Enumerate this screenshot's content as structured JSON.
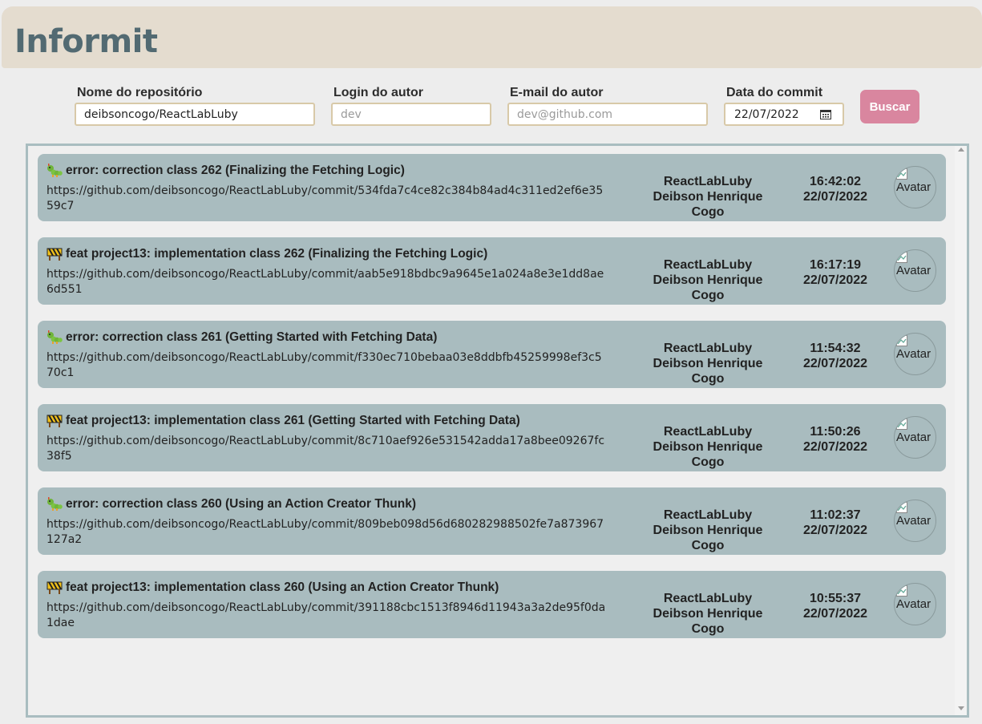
{
  "app": {
    "title": "Informit"
  },
  "filters": {
    "repo": {
      "label": "Nome do repositório",
      "value": "deibsoncogo/ReactLabLuby",
      "placeholder": ""
    },
    "login": {
      "label": "Login do autor",
      "value": "",
      "placeholder": "dev"
    },
    "email": {
      "label": "E-mail do autor",
      "value": "",
      "placeholder": "dev@github.com"
    },
    "date": {
      "label": "Data do commit",
      "value": "22/07/2022",
      "icon": "calendar-icon"
    },
    "search_label": "Buscar"
  },
  "colors": {
    "header_bg": "#e4dccf",
    "brand": "#526a72",
    "accent_button": "#d9869f",
    "card_bg": "#a9bcbf",
    "input_border": "#d8c9a8"
  },
  "commits": [
    {
      "icon": "caterpillar-icon",
      "message": "error: correction class 262 (Finalizing the Fetching Logic)",
      "url": "https://github.com/deibsoncogo/ReactLabLuby/commit/534fda7c4ce82c384b84ad4c311ed2ef6e3559c7",
      "repo": "ReactLabLuby",
      "author": "Deibson Henrique Cogo",
      "time": "16:42:02",
      "date": "22/07/2022",
      "avatar_alt": "Avatar"
    },
    {
      "icon": "construction-icon",
      "message": "feat project13: implementation class 262 (Finalizing the Fetching Logic)",
      "url": "https://github.com/deibsoncogo/ReactLabLuby/commit/aab5e918bdbc9a9645e1a024a8e3e1dd8ae6d551",
      "repo": "ReactLabLuby",
      "author": "Deibson Henrique Cogo",
      "time": "16:17:19",
      "date": "22/07/2022",
      "avatar_alt": "Avatar"
    },
    {
      "icon": "caterpillar-icon",
      "message": "error: correction class 261 (Getting Started with Fetching Data)",
      "url": "https://github.com/deibsoncogo/ReactLabLuby/commit/f330ec710bebaa03e8ddbfb45259998ef3c570c1",
      "repo": "ReactLabLuby",
      "author": "Deibson Henrique Cogo",
      "time": "11:54:32",
      "date": "22/07/2022",
      "avatar_alt": "Avatar"
    },
    {
      "icon": "construction-icon",
      "message": "feat project13: implementation class 261 (Getting Started with Fetching Data)",
      "url": "https://github.com/deibsoncogo/ReactLabLuby/commit/8c710aef926e531542adda17a8bee09267fc38f5",
      "repo": "ReactLabLuby",
      "author": "Deibson Henrique Cogo",
      "time": "11:50:26",
      "date": "22/07/2022",
      "avatar_alt": "Avatar"
    },
    {
      "icon": "caterpillar-icon",
      "message": "error: correction class 260 (Using an Action Creator Thunk)",
      "url": "https://github.com/deibsoncogo/ReactLabLuby/commit/809beb098d56d680282988502fe7a873967127a2",
      "repo": "ReactLabLuby",
      "author": "Deibson Henrique Cogo",
      "time": "11:02:37",
      "date": "22/07/2022",
      "avatar_alt": "Avatar"
    },
    {
      "icon": "construction-icon",
      "message": "feat project13: implementation class 260 (Using an Action Creator Thunk)",
      "url": "https://github.com/deibsoncogo/ReactLabLuby/commit/391188cbc1513f8946d11943a3a2de95f0da1dae",
      "repo": "ReactLabLuby",
      "author": "Deibson Henrique Cogo",
      "time": "10:55:37",
      "date": "22/07/2022",
      "avatar_alt": "Avatar"
    }
  ]
}
